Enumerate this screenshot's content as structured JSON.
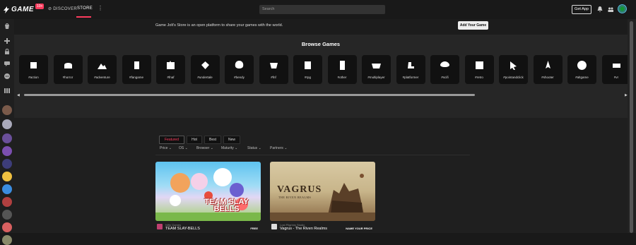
{
  "topbar": {
    "logo_text": "GAME",
    "logo_badge": "10+",
    "nav": {
      "discover": "DISCOVER",
      "store": "STORE",
      "more": "⋮"
    },
    "search_placeholder": "Search",
    "get_app": "Get App",
    "icons": [
      "bell-icon",
      "friends-icon",
      "user-avatar"
    ]
  },
  "banner": {
    "text": "Game Jolt's Store is an open platform to share your games with the world.",
    "add_button": "Add Your Game"
  },
  "browse": {
    "title": "Browse Games",
    "tiles": [
      {
        "label": "#action",
        "icon": "action-icon"
      },
      {
        "label": "#horror",
        "icon": "horror-icon"
      },
      {
        "label": "#adventure",
        "icon": "adventure-icon"
      },
      {
        "label": "#fangame",
        "icon": "fangame-icon"
      },
      {
        "label": "#fnaf",
        "icon": "fnaf-icon"
      },
      {
        "label": "#undertale",
        "icon": "undertale-icon"
      },
      {
        "label": "#bendy",
        "icon": "bendy-icon"
      },
      {
        "label": "#fnf",
        "icon": "fnf-icon"
      },
      {
        "label": "#rpg",
        "icon": "rpg-icon"
      },
      {
        "label": "#other",
        "icon": "other-icon"
      },
      {
        "label": "#multiplayer",
        "icon": "multiplayer-icon"
      },
      {
        "label": "#platformer",
        "icon": "platformer-icon"
      },
      {
        "label": "#scifi",
        "icon": "scifi-icon"
      },
      {
        "label": "#retro",
        "icon": "retro-icon"
      },
      {
        "label": "#pointandclick",
        "icon": "pointandclick-icon"
      },
      {
        "label": "#shooter",
        "icon": "shooter-icon"
      },
      {
        "label": "#altgame",
        "icon": "altgame-icon"
      },
      {
        "label": "#vr",
        "icon": "vr-icon"
      }
    ]
  },
  "tabs": [
    {
      "label": "Featured",
      "active": true
    },
    {
      "label": "Hot",
      "active": false
    },
    {
      "label": "Best",
      "active": false
    },
    {
      "label": "New",
      "active": false
    }
  ],
  "filters": [
    {
      "label": "Price"
    },
    {
      "label": "OS"
    },
    {
      "label": "Browser"
    },
    {
      "label": "Maturity"
    },
    {
      "label": "Status"
    },
    {
      "label": "Partners"
    }
  ],
  "games": [
    {
      "dev": "Nifty Games",
      "title": "TEAM SLAY-BELLS",
      "price": "FREE",
      "thumb_text": "TEAM SLAY BELLS"
    },
    {
      "dev": "Lost Pilgrims Studio",
      "title": "Vagrus - The Riven Realms",
      "price": "NAME YOUR PRICE",
      "thumb_text": "VAGRUS",
      "thumb_subtext": "THE RIVEN REALMS"
    }
  ],
  "colors": {
    "accent": "#fc3b5d",
    "background": "#191919",
    "panel": "#262626"
  }
}
